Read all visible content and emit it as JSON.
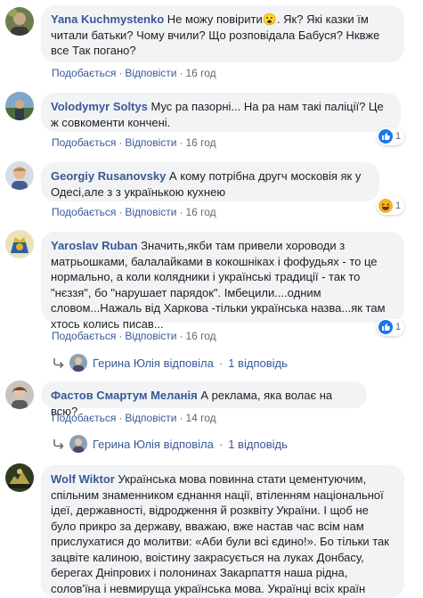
{
  "comments": [
    {
      "author": "Yana Kuchmystenko",
      "text": "Не можу повірити😮. Як? Які казки їм читали батьки? Чому вчили? Що розповідала Бабуся? Нквже все Так погано?",
      "like": "Подобається",
      "reply": "Відповісти",
      "time": "16 год"
    },
    {
      "author": "Volodymyr Soltys",
      "text": "Мус ра пазорні... На ра нам такі паліції? Це ж совкоменти кончені.",
      "like": "Подобається",
      "reply": "Відповісти",
      "time": "16 год",
      "reaction_count": "1",
      "reaction_icon": "like-icon"
    },
    {
      "author": "Georgiy Rusanovsky",
      "text": "А кому потрібна другч московія як у Одесі,але з з українькою кухнею",
      "like": "Подобається",
      "reply": "Відповісти",
      "time": "16 год",
      "reaction_count": "1",
      "reaction_icon": "haha-icon"
    },
    {
      "author": "Yaroslav Ruban",
      "text": "Значить,якби там привели хороводи з матрьошками, балалайками в кокошніках і фофудьях - то це нормально, а коли колядники і українські традиції - так то \"нєззя\", бо \"нарушает парядок\". Імбецили....одним словом...Нажаль від Харкова -тільки українська назва...як там хтось колись писав...",
      "like": "Подобається",
      "reply": "Відповісти",
      "time": "16 год",
      "reaction_count": "1",
      "reaction_icon": "like-icon",
      "replies": {
        "name": "Герина Юлія",
        "verb": "відповіла",
        "count": "1 відповідь"
      }
    },
    {
      "author": "Фастов Смартум Меланія",
      "text": "А реклама, яка волає на всю?",
      "like": "Подобається",
      "reply": "Відповісти",
      "time": "14 год",
      "replies": {
        "name": "Герина Юлія",
        "verb": "відповіла",
        "count": "1 відповідь"
      }
    },
    {
      "author": "Wolf Wiktor",
      "text": "Українська мова повинна стати цементуючим, спільним знаменником єднання нації, втіленням національної ідеї, державності, відродження й розквіту України. І щоб не було прикро за державу, вважаю, вже настав час всім нам прислухатися до молитви: «Аби були всі єдино!». Бо тільки так зацвіте калиною, воістину закрасується на луках Донбасу, берегах Дніпрових і полонинах Закарпаття наша рідна, солов'їна і невмируща українська мова. Українці всіх країн єднайтеся у мові! Саме це має стати нашою національною ідеєю."
    }
  ],
  "colors": {
    "link": "#385898",
    "bubble": "#f2f3f5",
    "meta": "#606770",
    "like_blue": "#1877f2",
    "haha_yellow": "#f7b125"
  }
}
